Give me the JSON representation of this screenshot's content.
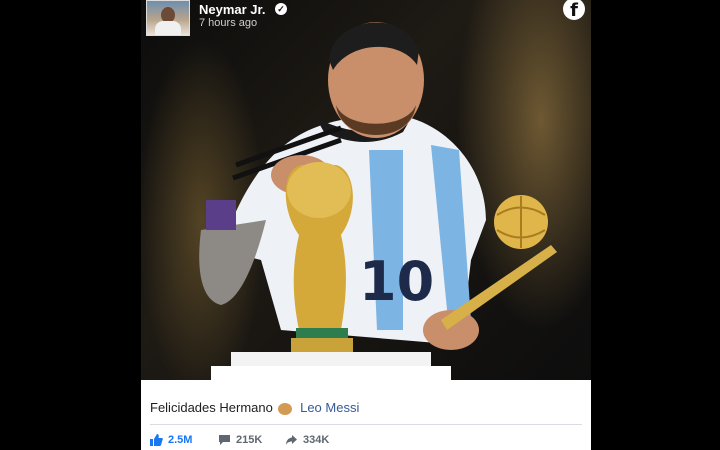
{
  "post": {
    "author": "Neymar Jr.",
    "time": "7 hours ago",
    "caption_text": "Felicidades Hermano",
    "mention": "Leo Messi",
    "jersey_number": "10"
  },
  "stats": {
    "likes": "2.5M",
    "comments": "215K",
    "shares": "334K"
  },
  "icons": {
    "facebook": "facebook-logo-icon",
    "verified": "verified-badge-icon",
    "like": "thumbs-up-icon",
    "comment": "comment-icon",
    "share": "share-arrow-icon"
  },
  "colors": {
    "like_blue": "#1877f2",
    "mention_blue": "#385898",
    "gold": "#d4a93a",
    "jersey_blue": "#7cb4e3"
  }
}
